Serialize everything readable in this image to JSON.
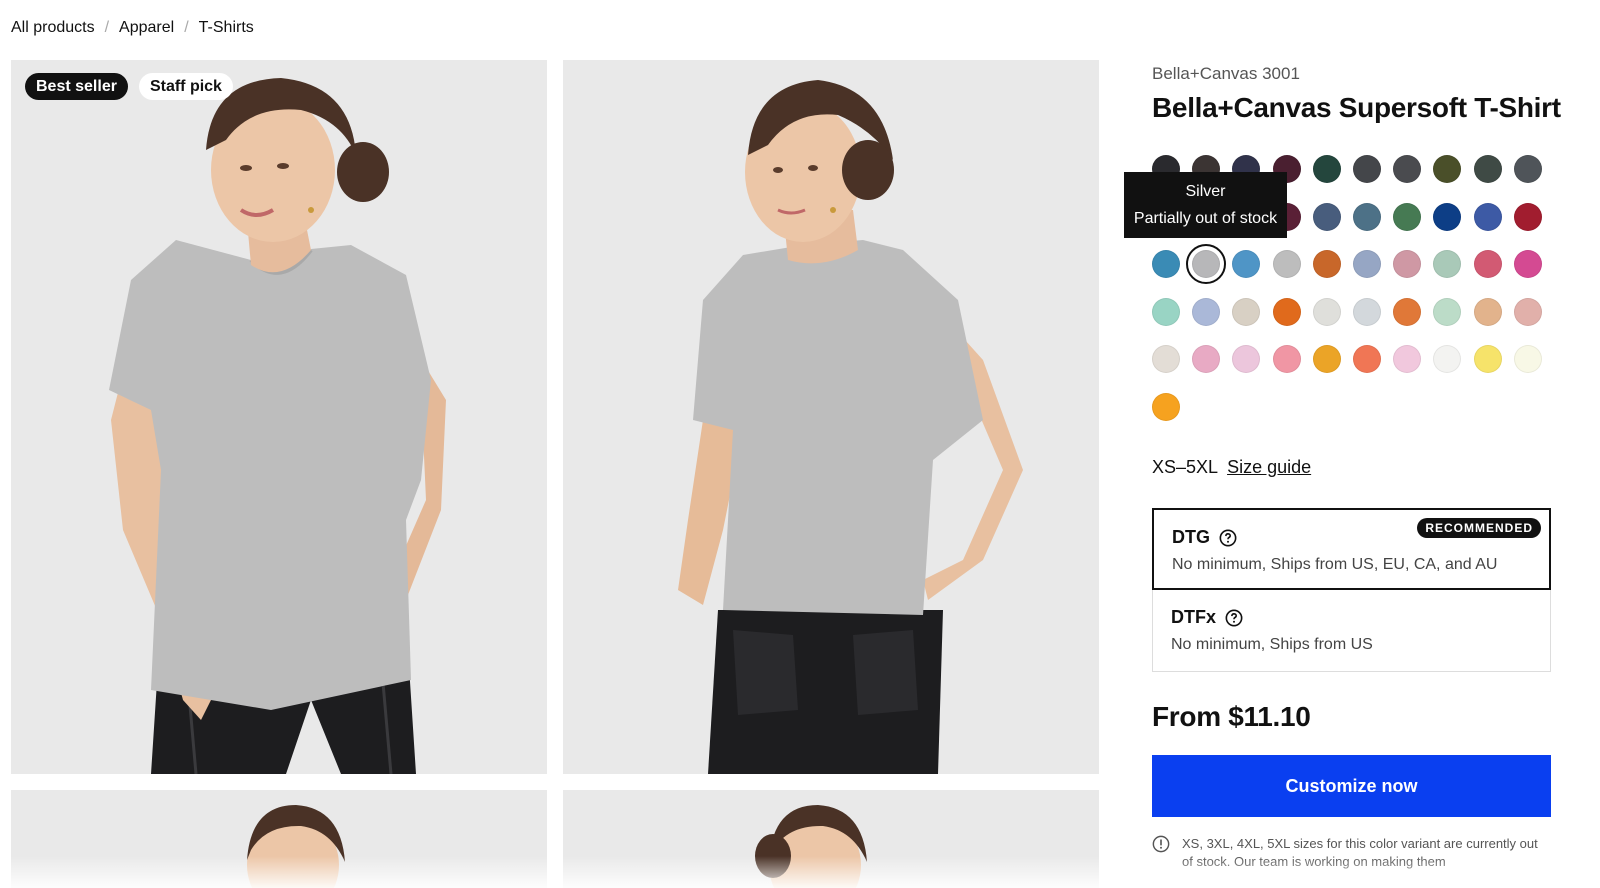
{
  "breadcrumb": {
    "items": [
      "All products",
      "Apparel",
      "T-Shirts"
    ],
    "separator": "/"
  },
  "badges": {
    "best_seller": "Best seller",
    "staff_pick": "Staff pick"
  },
  "product": {
    "brand": "Bella+Canvas 3001",
    "title": "Bella+Canvas Supersoft T-Shirt",
    "sizes": "XS–5XL",
    "size_guide": "Size guide",
    "price": "From $11.10"
  },
  "colors": {
    "selected_index": 21,
    "swatches": [
      "#2a2a2e",
      "#3b3433",
      "#30324a",
      "#4a1f30",
      "#24463d",
      "#44464a",
      "#4a4b4f",
      "#4a4f29",
      "#3f4a45",
      "#4f5459",
      "#34394a",
      "#3a3f4f",
      "#38404a",
      "#5a2036",
      "#485d7d",
      "#4d7187",
      "#467a53",
      "#0d3e86",
      "#3d5aa5",
      "#a11d2f",
      "#3a8bb5",
      "#b7b7b9",
      "#4f95c6",
      "#bdbdbd",
      "#c8672a",
      "#96a6c4",
      "#cf98a4",
      "#a9c9b8",
      "#d25a73",
      "#d44a92",
      "#99d4c4",
      "#aab8d8",
      "#d8d0c4",
      "#e06a1c",
      "#dfdfdb",
      "#d3d8dc",
      "#e07838",
      "#bcdcc8",
      "#e2b38c",
      "#e1b0aa",
      "#e3ddd6",
      "#e8aac4",
      "#ecc6dc",
      "#f096a4",
      "#eba427",
      "#f07655",
      "#f1c8dd",
      "#f3f3f1",
      "#f6e36a",
      "#f8f8e6",
      "#f6a21f"
    ],
    "tooltip": {
      "name": "Silver",
      "status": "Partially out of stock"
    }
  },
  "print_options": [
    {
      "name": "DTG",
      "description": "No minimum, Ships from US, EU, CA, and AU",
      "badge": "RECOMMENDED",
      "selected": true
    },
    {
      "name": "DTFx",
      "description": "No minimum, Ships from US",
      "badge": "",
      "selected": false
    }
  ],
  "cta": {
    "label": "Customize now",
    "color": "#0a3ff0"
  },
  "notice": {
    "text": "XS, 3XL, 4XL, 5XL sizes for this color variant are currently out of stock. Our team is working on making them"
  }
}
